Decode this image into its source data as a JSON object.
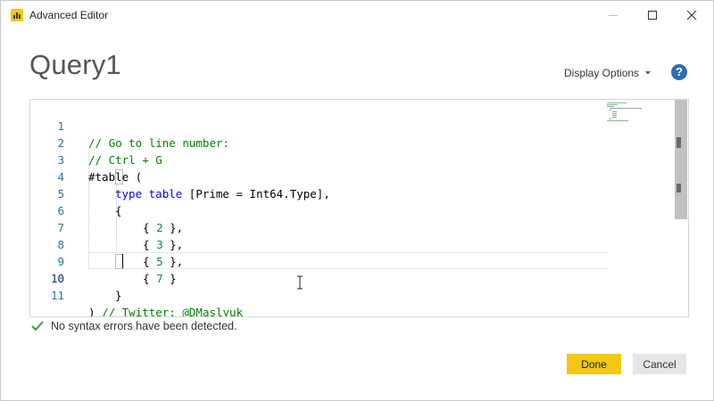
{
  "window": {
    "title": "Advanced Editor",
    "controls": {
      "minimize": "minimize-icon",
      "maximize": "maximize-icon",
      "close": "close-icon"
    },
    "app_icon": "power-bi-icon"
  },
  "header": {
    "query_name": "Query1",
    "display_options_label": "Display Options",
    "help_icon": "?"
  },
  "editor": {
    "active_line": "10",
    "lines": [
      {
        "number": "1",
        "text": "// Go to line number:"
      },
      {
        "number": "2",
        "text": "// Ctrl + G"
      },
      {
        "number": "3",
        "text": "#table ("
      },
      {
        "number": "4",
        "text": "    type table [Prime = Int64.Type],"
      },
      {
        "number": "5",
        "text": "    {"
      },
      {
        "number": "6",
        "text": "        { 2 },"
      },
      {
        "number": "7",
        "text": "        { 3 },"
      },
      {
        "number": "8",
        "text": "        { 5 },"
      },
      {
        "number": "9",
        "text": "        { 7 }"
      },
      {
        "number": "10",
        "text": "    }"
      },
      {
        "number": "11",
        "text": ") // Twitter: @DMaslyuk"
      }
    ],
    "tokens": {
      "l1": "// Go to line number:",
      "l2": "// Ctrl + G",
      "l3": "#table (",
      "l4_kw1": "type",
      "l4_kw2": "table",
      "l4_rest": " [Prime = Int64.Type],",
      "l5": "{",
      "l6_open": "{ ",
      "l6_num": "2",
      "l6_close": " },",
      "l7_open": "{ ",
      "l7_num": "3",
      "l7_close": " },",
      "l8_open": "{ ",
      "l8_num": "5",
      "l8_close": " },",
      "l9_open": "{ ",
      "l9_num": "7",
      "l9_close": " }",
      "l10": "}",
      "l11_paren": ") ",
      "l11_cmt": "// Twitter: @DMaslyuk"
    }
  },
  "status": {
    "icon": "checkmark-icon",
    "text": "No syntax errors have been detected.",
    "color": "#3a9b3a"
  },
  "buttons": {
    "done": "Done",
    "cancel": "Cancel"
  },
  "colors": {
    "accent": "#f2c811",
    "help": "#2d6db3",
    "comment": "#008000",
    "keyword": "#0000ff",
    "number": "#098658",
    "line_number": "#237893"
  }
}
